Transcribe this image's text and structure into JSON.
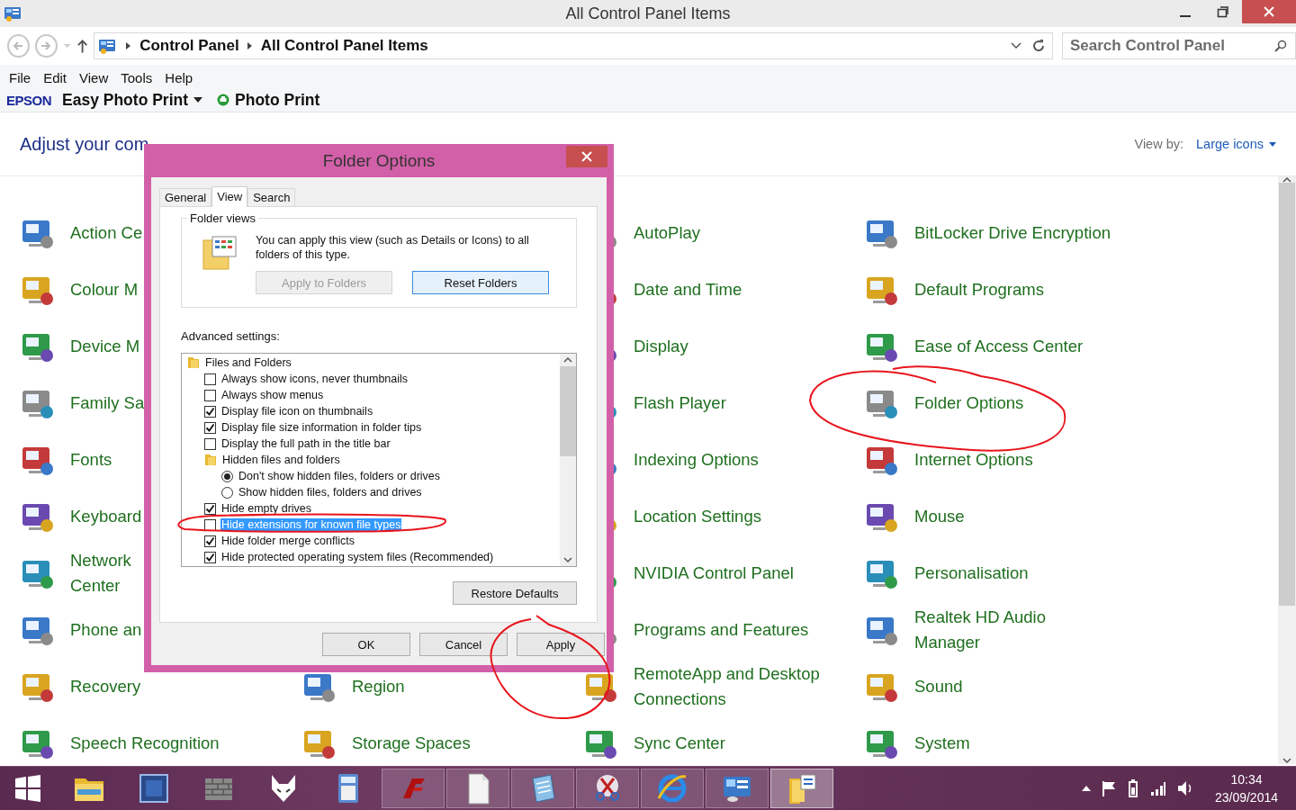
{
  "window": {
    "title": "All Control Panel Items"
  },
  "address_bar": {
    "breadcrumbs": [
      "Control Panel",
      "All Control Panel Items"
    ]
  },
  "search": {
    "placeholder": "Search Control Panel"
  },
  "menu": [
    "File",
    "Edit",
    "View",
    "Tools",
    "Help"
  ],
  "toolbar": {
    "brand": "EPSON",
    "items": [
      {
        "label": "Easy Photo Print",
        "kind": "dropdown"
      },
      {
        "label": "Photo Print",
        "kind": "button"
      }
    ]
  },
  "header": {
    "title": "Adjust your com",
    "view_by_label": "View by:",
    "view_by_value": "Large icons"
  },
  "applet_columns": [
    [
      "Action Ce",
      "Colour M",
      "Device M",
      "Family Sa",
      "Fonts",
      "Keyboard",
      "Network\nCenter",
      "Phone an",
      "Recovery",
      "Speech Recognition"
    ],
    [
      "Region",
      "Storage Spaces"
    ],
    [
      "AutoPlay",
      "Date and Time",
      "Display",
      "Flash Player",
      "Indexing Options",
      "Location Settings",
      "NVIDIA Control Panel",
      "Programs and Features",
      "RemoteApp and Desktop\nConnections",
      "Sync Center"
    ],
    [
      "BitLocker Drive Encryption",
      "Default Programs",
      "Ease of Access Center",
      "Folder Options",
      "Internet Options",
      "Mouse",
      "Personalisation",
      "Realtek HD Audio\nManager",
      "Sound",
      "System"
    ]
  ],
  "dialog": {
    "title": "Folder Options",
    "tabs": [
      {
        "label": "General",
        "selected": false
      },
      {
        "label": "View",
        "selected": true
      },
      {
        "label": "Search",
        "selected": false
      }
    ],
    "folder_views": {
      "title": "Folder views",
      "text": "You can apply this view (such as Details or Icons) to all folders of this type.",
      "buttons": [
        {
          "label": "Apply to Folders",
          "disabled": true,
          "focused": false
        },
        {
          "label": "Reset Folders",
          "disabled": false,
          "focused": true
        }
      ]
    },
    "advanced_label": "Advanced settings:",
    "settings": [
      {
        "kind": "group",
        "label": "Files and Folders",
        "selected": false,
        "children": [
          {
            "kind": "checkbox",
            "label": "Always show icons, never thumbnails",
            "checked": false,
            "selected": false
          },
          {
            "kind": "checkbox",
            "label": "Always show menus",
            "checked": false,
            "selected": false
          },
          {
            "kind": "checkbox",
            "label": "Display file icon on thumbnails",
            "checked": true,
            "selected": false
          },
          {
            "kind": "checkbox",
            "label": "Display file size information in folder tips",
            "checked": true,
            "selected": false
          },
          {
            "kind": "checkbox",
            "label": "Display the full path in the title bar",
            "checked": false,
            "selected": false
          },
          {
            "kind": "group",
            "label": "Hidden files and folders",
            "selected": false,
            "children": [
              {
                "kind": "radio",
                "label": "Don't show hidden files, folders or drives",
                "checked": true,
                "selected": false
              },
              {
                "kind": "radio",
                "label": "Show hidden files, folders and drives",
                "checked": false,
                "selected": false
              }
            ]
          },
          {
            "kind": "checkbox",
            "label": "Hide empty drives",
            "checked": true,
            "selected": false
          },
          {
            "kind": "checkbox",
            "label": "Hide extensions for known file types",
            "checked": false,
            "selected": true
          },
          {
            "kind": "checkbox",
            "label": "Hide folder merge conflicts",
            "checked": true,
            "selected": false
          },
          {
            "kind": "checkbox",
            "label": "Hide protected operating system files (Recommended)",
            "checked": true,
            "selected": false
          }
        ]
      }
    ],
    "restore_button": "Restore Defaults",
    "buttons": [
      "OK",
      "Cancel",
      "Apply"
    ]
  },
  "taskbar": {
    "apps": [
      {
        "running": false,
        "selected": false
      },
      {
        "running": false,
        "selected": false
      },
      {
        "running": false,
        "selected": false
      },
      {
        "running": false,
        "selected": false
      },
      {
        "running": false,
        "selected": false
      },
      {
        "running": true,
        "selected": false
      },
      {
        "running": true,
        "selected": false
      },
      {
        "running": true,
        "selected": false
      },
      {
        "running": true,
        "selected": false
      },
      {
        "running": true,
        "selected": false
      },
      {
        "running": true,
        "selected": false
      },
      {
        "running": true,
        "selected": true
      }
    ],
    "time": "10:34",
    "date": "23/09/2014"
  }
}
